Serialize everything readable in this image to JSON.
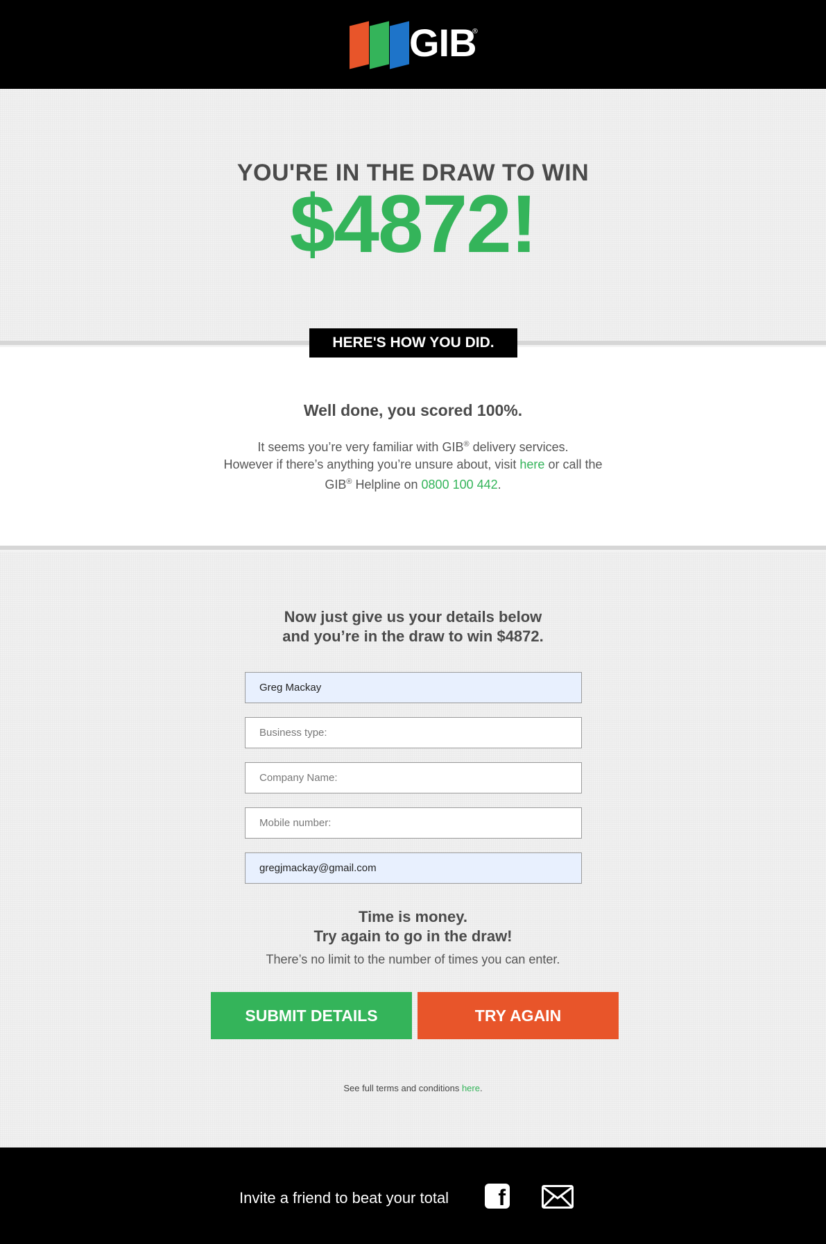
{
  "header": {
    "logo_text": "GIB",
    "logo_reg": "®"
  },
  "hero": {
    "line1": "YOU'RE IN THE DRAW TO WIN",
    "amount": "$4872!"
  },
  "results": {
    "banner": "HERE'S HOW YOU DID.",
    "score": "Well done, you scored 100%.",
    "para_part1": "It seems you’re very familiar with GIB",
    "reg": "®",
    "para_part2": " delivery services.",
    "para_part3": "However if there’s anything you’re unsure about, visit ",
    "link_here": "here",
    "para_part4": " or call the",
    "para_part5": "GIB",
    "para_part6": " Helpline on ",
    "phone": "0800 100 442",
    "period": "."
  },
  "form": {
    "intro_line1": "Now just give us your details below",
    "intro_line2": "and you’re in the draw to win $4872.",
    "fields": {
      "name": {
        "value": "Greg Mackay",
        "placeholder": ""
      },
      "business_type": {
        "value": "",
        "placeholder": "Business type:"
      },
      "company": {
        "value": "",
        "placeholder": "Company Name:"
      },
      "mobile": {
        "value": "",
        "placeholder": "Mobile number:"
      },
      "email": {
        "value": "gregjmackay@gmail.com",
        "placeholder": ""
      }
    },
    "time_line1": "Time is money.",
    "time_line2": "Try again to go in the draw!",
    "time_line3": "There’s no limit to the number of times you can enter.",
    "submit_label": "SUBMIT DETAILS",
    "retry_label": "TRY AGAIN",
    "terms_text": "See full terms and conditions ",
    "terms_link": "here",
    "terms_end": "."
  },
  "footer": {
    "invite": "Invite a friend to beat your total",
    "icons": [
      "facebook-icon",
      "mail-icon"
    ]
  },
  "colors": {
    "green": "#34b45a",
    "orange": "#e8552a",
    "blue": "#1e74c9",
    "black": "#000000"
  }
}
